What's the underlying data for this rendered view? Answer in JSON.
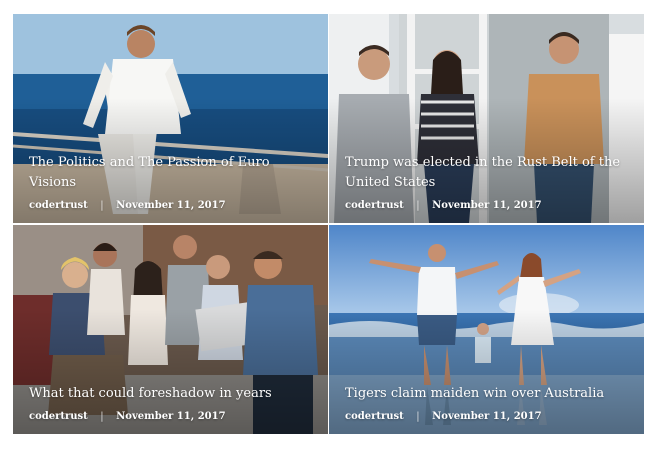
{
  "posts": [
    {
      "title": "The Politics and The Passion of Euro Visions",
      "author": "codertrust",
      "separator": "|",
      "date": "November 11, 2017",
      "image": "man-on-yacht-by-sea-photo"
    },
    {
      "title": "Trump was elected in the Rust Belt of the United States",
      "author": "codertrust",
      "separator": "|",
      "date": "November 11, 2017",
      "image": "team-meeting-in-office-photo"
    },
    {
      "title": "What that could foreshadow in years",
      "author": "codertrust",
      "separator": "|",
      "date": "November 11, 2017",
      "image": "group-around-laptop-photo"
    },
    {
      "title": "Tigers claim maiden win over Australia",
      "author": "codertrust",
      "separator": "|",
      "date": "November 11, 2017",
      "image": "family-on-beach-photo"
    }
  ]
}
